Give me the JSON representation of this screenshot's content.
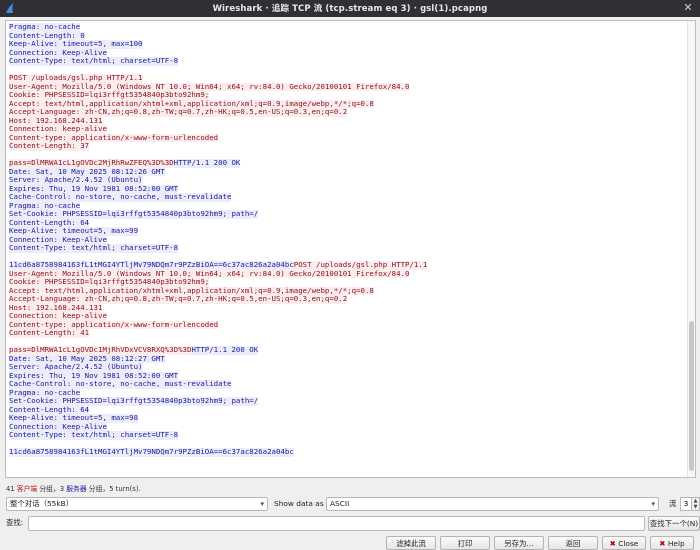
{
  "window": {
    "title": "Wireshark · 追踪 TCP 流 (tcp.stream eq 3) · gsl(1).pcapng",
    "close_glyph": "✕"
  },
  "stream": {
    "lines": [
      {
        "dir": "s",
        "text": "Pragma: no-cache"
      },
      {
        "dir": "s",
        "text": "Content-Length: 0"
      },
      {
        "dir": "s",
        "text": "Keep-Alive: timeout=5, max=100"
      },
      {
        "dir": "s",
        "text": "Connection: Keep-Alive"
      },
      {
        "dir": "s",
        "text": "Content-Type: text/html; charset=UTF-8"
      },
      {
        "dir": "blank",
        "text": ""
      },
      {
        "dir": "c",
        "text": "POST /uploads/gsl.php HTTP/1.1"
      },
      {
        "dir": "c",
        "text": "User-Agent: Mozilla/5.0 (Windows NT 10.0; Win64; x64; rv:84.0) Gecko/20100101 Firefox/84.0"
      },
      {
        "dir": "c",
        "text": "Cookie: PHPSESSID=lqi3rffgt5354840p3bto92hm9;"
      },
      {
        "dir": "c",
        "text": "Accept: text/html,application/xhtml+xml,application/xml;q=0.9,image/webp,*/*;q=0.8"
      },
      {
        "dir": "c",
        "text": "Accept-Language: zh-CN,zh;q=0.8,zh-TW;q=0.7,zh-HK;q=0.5,en-US;q=0.3,en;q=0.2"
      },
      {
        "dir": "c",
        "text": "Host: 192.168.244.131"
      },
      {
        "dir": "c",
        "text": "Connection: keep-alive"
      },
      {
        "dir": "c",
        "text": "Content-type: application/x-www-form-urlencoded"
      },
      {
        "dir": "c",
        "text": "Content-Length: 37"
      },
      {
        "dir": "blank",
        "text": ""
      },
      {
        "dir": "mix",
        "c": "pass=DlMRWA1cL1gOVDc2MjRhRwZFEQ%3D%3D",
        "s": "HTTP/1.1 200 OK"
      },
      {
        "dir": "s",
        "text": "Date: Sat, 10 May 2025 08:12:26 GMT"
      },
      {
        "dir": "s",
        "text": "Server: Apache/2.4.52 (Ubuntu)"
      },
      {
        "dir": "s",
        "text": "Expires: Thu, 19 Nov 1981 08:52:00 GMT"
      },
      {
        "dir": "s",
        "text": "Cache-Control: no-store, no-cache, must-revalidate"
      },
      {
        "dir": "s",
        "text": "Pragma: no-cache"
      },
      {
        "dir": "s",
        "text": "Set-Cookie: PHPSESSID=lqi3rffgt5354840p3bto92hm9; path=/"
      },
      {
        "dir": "s",
        "text": "Content-Length: 64"
      },
      {
        "dir": "s",
        "text": "Keep-Alive: timeout=5, max=99"
      },
      {
        "dir": "s",
        "text": "Connection: Keep-Alive"
      },
      {
        "dir": "s",
        "text": "Content-Type: text/html; charset=UTF-8"
      },
      {
        "dir": "blank",
        "text": ""
      },
      {
        "dir": "mix2",
        "s": "11cd6a8758984163fL1tMGI4YTljMv79NDQm7r9PZzBiOA==6c37ac826a2a04bc",
        "c": "POST /uploads/gsl.php HTTP/1.1"
      },
      {
        "dir": "c",
        "text": "User-Agent: Mozilla/5.0 (Windows NT 10.0; Win64; x64; rv:84.0) Gecko/20100101 Firefox/84.0"
      },
      {
        "dir": "c",
        "text": "Cookie: PHPSESSID=lqi3rffgt5354840p3bto92hm9;"
      },
      {
        "dir": "c",
        "text": "Accept: text/html,application/xhtml+xml,application/xml;q=0.9,image/webp,*/*;q=0.8"
      },
      {
        "dir": "c",
        "text": "Accept-Language: zh-CN,zh;q=0.8,zh-TW;q=0.7,zh-HK;q=0.5,en-US;q=0.3,en;q=0.2"
      },
      {
        "dir": "c",
        "text": "Host: 192.168.244.131"
      },
      {
        "dir": "c",
        "text": "Connection: keep-alive"
      },
      {
        "dir": "c",
        "text": "Content-type: application/x-www-form-urlencoded"
      },
      {
        "dir": "c",
        "text": "Content-Length: 41"
      },
      {
        "dir": "blank",
        "text": ""
      },
      {
        "dir": "mix",
        "c": "pass=DlMRWA1cL1gOVDc1MjRhVDxVCV8RXQ%3D%3D",
        "s": "HTTP/1.1 200 OK"
      },
      {
        "dir": "s",
        "text": "Date: Sat, 10 May 2025 08:12:27 GMT"
      },
      {
        "dir": "s",
        "text": "Server: Apache/2.4.52 (Ubuntu)"
      },
      {
        "dir": "s",
        "text": "Expires: Thu, 19 Nov 1981 08:52:00 GMT"
      },
      {
        "dir": "s",
        "text": "Cache-Control: no-store, no-cache, must-revalidate"
      },
      {
        "dir": "s",
        "text": "Pragma: no-cache"
      },
      {
        "dir": "s",
        "text": "Set-Cookie: PHPSESSID=lqi3rffgt5354840p3bto92hm9; path=/"
      },
      {
        "dir": "s",
        "text": "Content-Length: 64"
      },
      {
        "dir": "s",
        "text": "Keep-Alive: timeout=5, max=98"
      },
      {
        "dir": "s",
        "text": "Connection: Keep-Alive"
      },
      {
        "dir": "s",
        "text": "Content-Type: text/html; charset=UTF-8"
      },
      {
        "dir": "blank",
        "text": ""
      },
      {
        "dir": "s",
        "text": "11cd6a8758984163fL1tMGI4YTljMv79NDQm7r9PZzBiOA==6c37ac826a2a04bc"
      }
    ]
  },
  "stats": {
    "prefix": "41 ",
    "client_label": "客户端",
    "mid1": " 分组，3 ",
    "server_label": "服务器",
    "mid2": " 分组，5 turn(s)."
  },
  "controls": {
    "conversation_select": "整个对话（55kB）",
    "show_data_as_label": "Show data as",
    "show_data_as_value": "ASCII",
    "stream_label": "流",
    "stream_value": "3",
    "find_label": "查找:",
    "find_value": "",
    "find_next_button": "查找下一个(N)"
  },
  "buttons": {
    "filter_out": "滤掉此流",
    "print": "打印",
    "save_as": "另存为…",
    "back": "返回",
    "close": "Close",
    "help": "Help"
  },
  "colors": {
    "client_text": "#8b0f1c",
    "client_bg": "#fbeded",
    "server_text": "#1a1b9b",
    "server_bg": "#ececfa"
  },
  "icons": {
    "app_logo": "wireshark-fin-icon",
    "window_close": "close-icon",
    "dropdown": "chevron-down-icon",
    "help": "help-icon",
    "close": "close-icon"
  }
}
